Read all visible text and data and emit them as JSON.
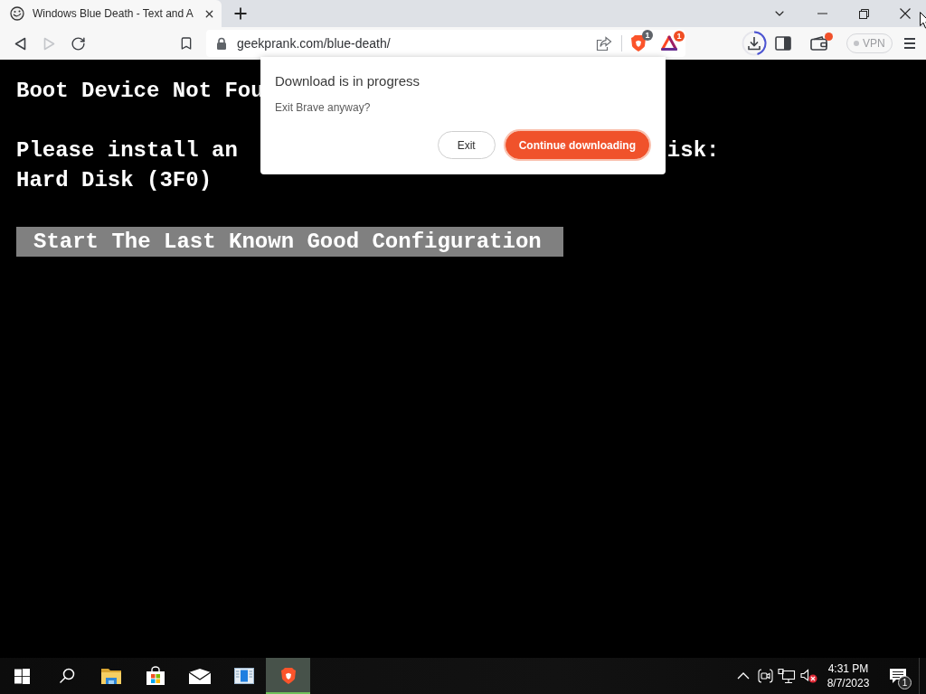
{
  "browser": {
    "tabs": [
      {
        "title": "Windows Blue Death - Text and A",
        "selected": true
      }
    ],
    "nav_buttons": [
      {
        "kind": "back",
        "disabled": false
      },
      {
        "kind": "forward",
        "disabled": true
      },
      {
        "kind": "reload",
        "disabled": false
      }
    ],
    "address_bar": {
      "url": "geekprank.com/blue-death/"
    },
    "extensions": [
      {
        "kind": "shields",
        "badge": "1"
      },
      {
        "kind": "rewards",
        "badge": "1"
      }
    ],
    "toolbar": {
      "wallet": {
        "alert": true
      },
      "vpn": {
        "label": "VPN",
        "on": false
      }
    }
  },
  "boot_screen": {
    "heading": "Boot Device Not Fou",
    "message_start": "Please install an",
    "message_end": "isk:",
    "detail": "Hard Disk (3F0)",
    "option": {
      "label": "Start The Last Known Good Configuration",
      "selected": true
    }
  },
  "dialog": {
    "title": "Download is in progress",
    "message": "Exit Brave anyway?",
    "buttons": [
      {
        "label": "Exit",
        "kind": "secondary",
        "focused": false
      },
      {
        "label": "Continue downloading",
        "kind": "primary",
        "focused": true
      }
    ]
  },
  "taskbar": {
    "apps": [
      {
        "kind": "explorer",
        "active": false
      },
      {
        "kind": "store",
        "active": false
      },
      {
        "kind": "mail",
        "active": false
      },
      {
        "kind": "window",
        "active": false
      },
      {
        "kind": "brave",
        "active": true
      }
    ],
    "tray": {
      "muted": true,
      "time": "4:31 PM",
      "date": "8/7/2023",
      "notification_count": "1"
    }
  }
}
